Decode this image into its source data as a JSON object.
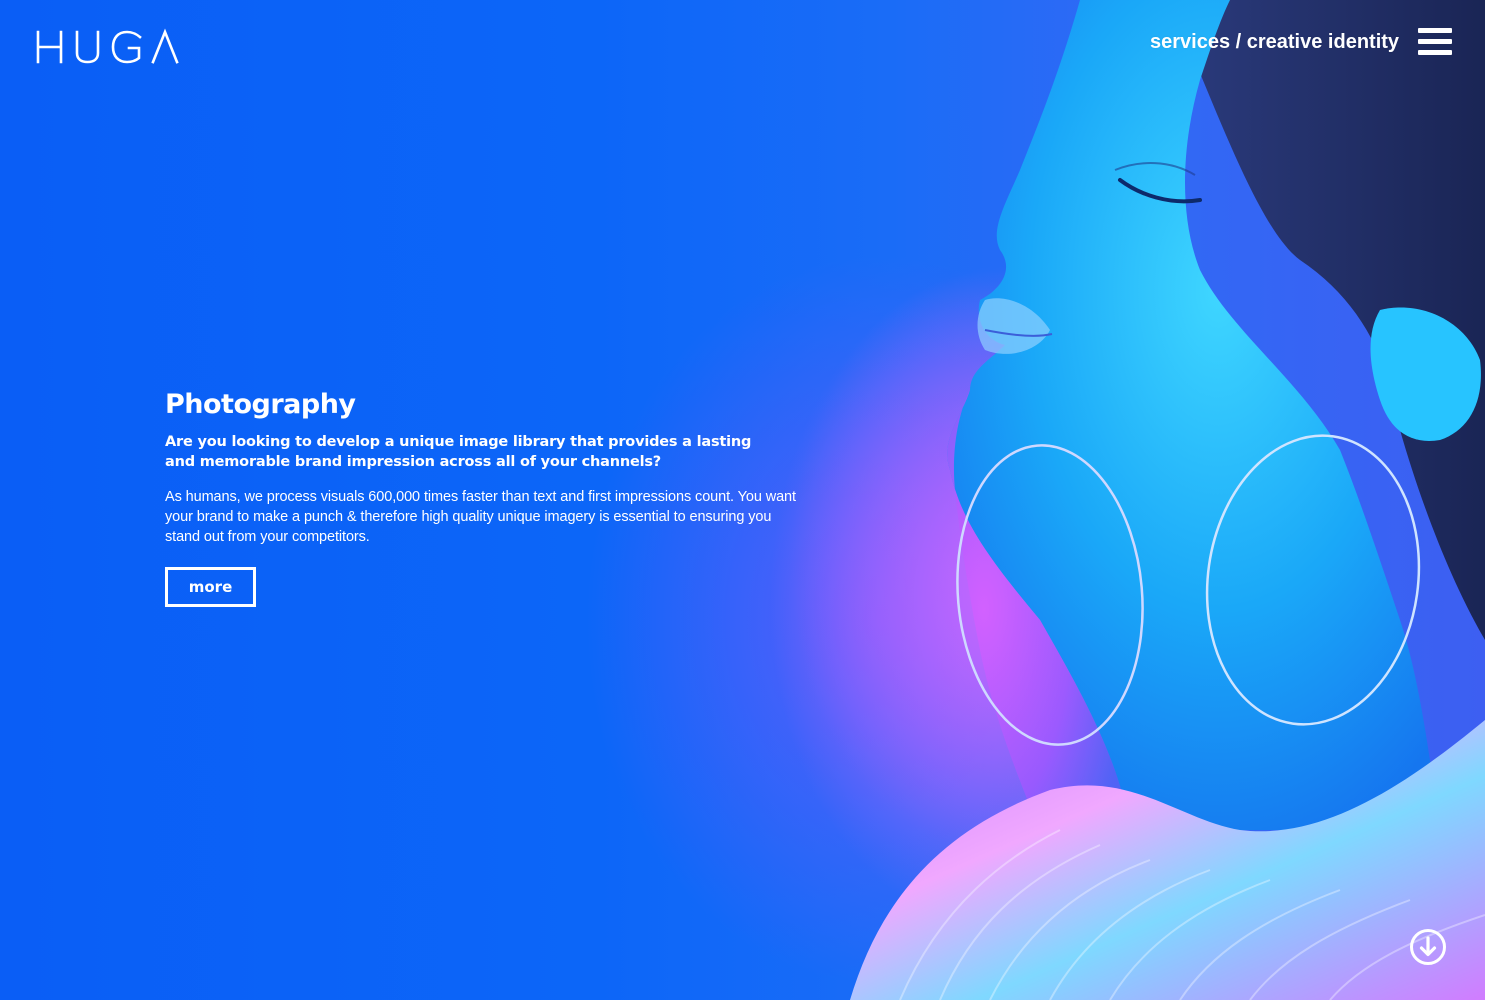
{
  "brand": {
    "logo_text": "HUGA"
  },
  "header": {
    "breadcrumb": "services / creative identity",
    "menu_icon": "hamburger-menu-icon"
  },
  "main": {
    "title": "Photography",
    "lead": "Are you looking to develop a unique image library that provides a lasting and memorable brand impression across all of your channels?",
    "body": "As humans, we process visuals 600,000 times faster than text and first impressions count. You want your brand to make a punch & therefore high quality unique imagery is essential to ensuring you stand out from your competitors.",
    "cta_label": "more"
  },
  "footer": {
    "scroll_icon": "arrow-down-circle-icon"
  },
  "colors": {
    "background_blue": "#0a5cf5",
    "text": "#ffffff",
    "accent_magenta": "#c85cff",
    "accent_cyan": "#1fd3ff"
  }
}
